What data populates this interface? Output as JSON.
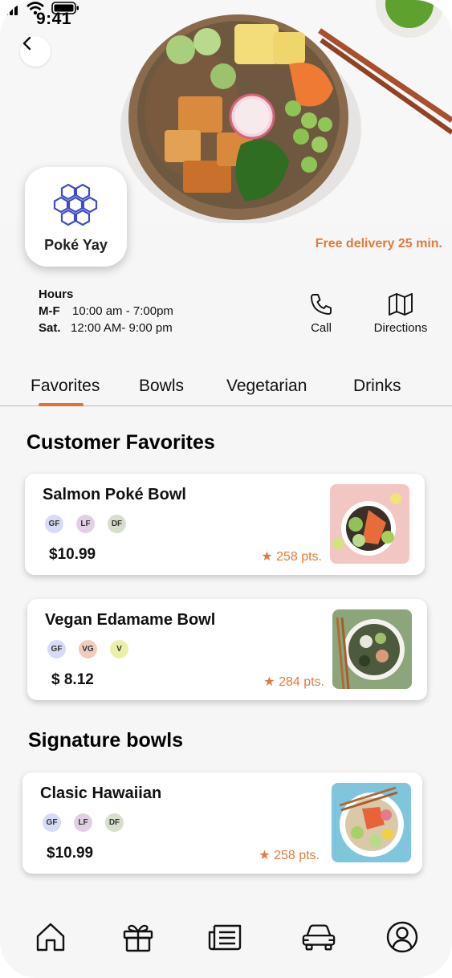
{
  "status_bar": {
    "time": "9:41"
  },
  "restaurant": {
    "name": "Poké Yay",
    "delivery": "Free delivery 25 min.",
    "hours_title": "Hours",
    "hours": [
      {
        "days": "M-F",
        "time": "10:00 am - 7:00pm"
      },
      {
        "days": "Sat.",
        "time": "12:00 AM- 9:00 pm"
      }
    ],
    "actions": {
      "call": "Call",
      "directions": "Directions"
    }
  },
  "tabs": [
    {
      "label": "Favorites",
      "active": true
    },
    {
      "label": "Bowls",
      "active": false
    },
    {
      "label": "Vegetarian",
      "active": false
    },
    {
      "label": "Drinks",
      "active": false
    }
  ],
  "sections": {
    "favorites_title": "Customer Favorites",
    "signature_title": "Signature bowls"
  },
  "menu_items": [
    {
      "name": "Salmon Poké Bowl",
      "tags": [
        "GF",
        "LF",
        "DF"
      ],
      "price": "$10.99",
      "points": "★ 258 pts."
    },
    {
      "name": "Vegan Edamame Bowl",
      "tags": [
        "GF",
        "VG",
        "V"
      ],
      "price": "$ 8.12",
      "points": "★ 284 pts."
    },
    {
      "name": "Clasic Hawaiian",
      "tags": [
        "GF",
        "LF",
        "DF"
      ],
      "price": "$10.99",
      "points": "★ 258 pts."
    }
  ],
  "colors": {
    "accent": "#e07b39",
    "tag_gf": "#d6dcf5",
    "tag_lf": "#e2cfe3",
    "tag_df": "#d7dfcc",
    "tag_vg": "#f0ccbc",
    "tag_v": "#ecefa8"
  },
  "icons": {
    "back": "chevron-left-icon",
    "call": "phone-icon",
    "directions": "map-icon",
    "nav": [
      "home-icon",
      "gift-icon",
      "news-icon",
      "car-icon",
      "profile-icon"
    ]
  }
}
